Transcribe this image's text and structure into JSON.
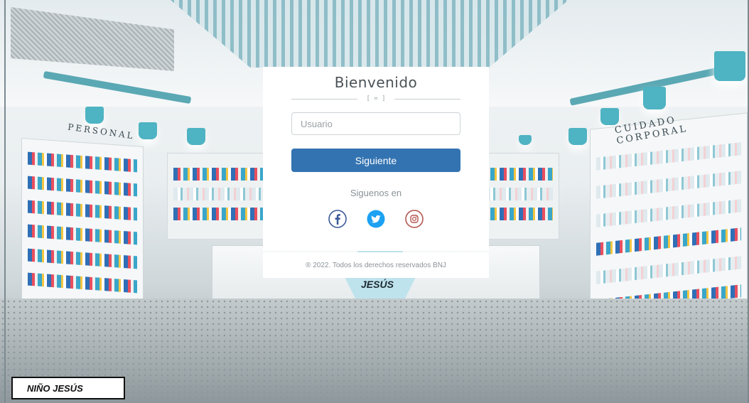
{
  "login": {
    "title": "Bienvenido",
    "divider_mark": "[ = ]",
    "username_placeholder": "Usuario",
    "next_button": "Siguiente",
    "follow_text": "Siguenos en",
    "socials": [
      {
        "name": "facebook",
        "icon": "facebook-icon",
        "color": "#3b5998"
      },
      {
        "name": "twitter",
        "icon": "twitter-icon",
        "color": "#1da1f2"
      },
      {
        "name": "instagram",
        "icon": "instagram-icon",
        "color": "#b3564e"
      }
    ],
    "footer": "® 2022. Todos los derechos reservados BNJ"
  },
  "background": {
    "left_sign": "PERSONAL",
    "right_sign": "CUIDADO CORPORAL",
    "counter_sign": "JESÚS"
  },
  "brand": {
    "name": "NIÑO JESÚS"
  },
  "colors": {
    "primary": "#3373b1",
    "accent": "#4eb3c2"
  }
}
